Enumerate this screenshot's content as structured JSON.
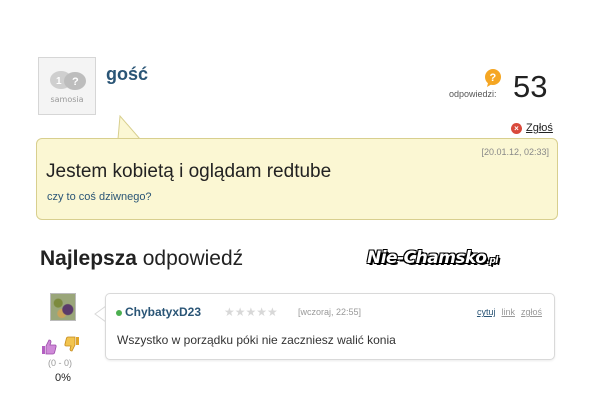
{
  "question": {
    "username": "gość",
    "avatar_logo": "samosia",
    "answers_label": "odpowiedzi:",
    "answers_count": "53",
    "report_label": "Zgłoś",
    "date": "[20.01.12, 02:33]",
    "title": "Jestem kobietą i oglądam redtube",
    "subtitle": "czy to coś dziwnego?"
  },
  "best_answer": {
    "heading_bold": "Najlepsza",
    "heading_rest": " odpowiedź",
    "username": "ChybatyxD23",
    "stars": "★★★★★",
    "rating": 0,
    "date": "[wczoraj, 22:55]",
    "links": {
      "quote": "cytuj",
      "link": "link",
      "report": "zgłoś"
    },
    "text": "Wszystko w porządku póki nie zaczniesz walić konia",
    "votes": "(0 - 0)",
    "percent": "0%"
  },
  "watermark": {
    "main": "Nie-Chamsko",
    "suffix": ".pl"
  },
  "icons": {
    "answers": "question-bubble-icon",
    "report": "report-x-icon",
    "vote_up": "thumbs-up-icon",
    "vote_down": "thumbs-down-icon"
  },
  "colors": {
    "question_bg": "#fbf7d3",
    "question_border": "#d8cf8e",
    "link_blue": "#2a5576",
    "report_red": "#d9493b",
    "answers_icon": "#f5a623",
    "online_dot": "#4caf50"
  }
}
